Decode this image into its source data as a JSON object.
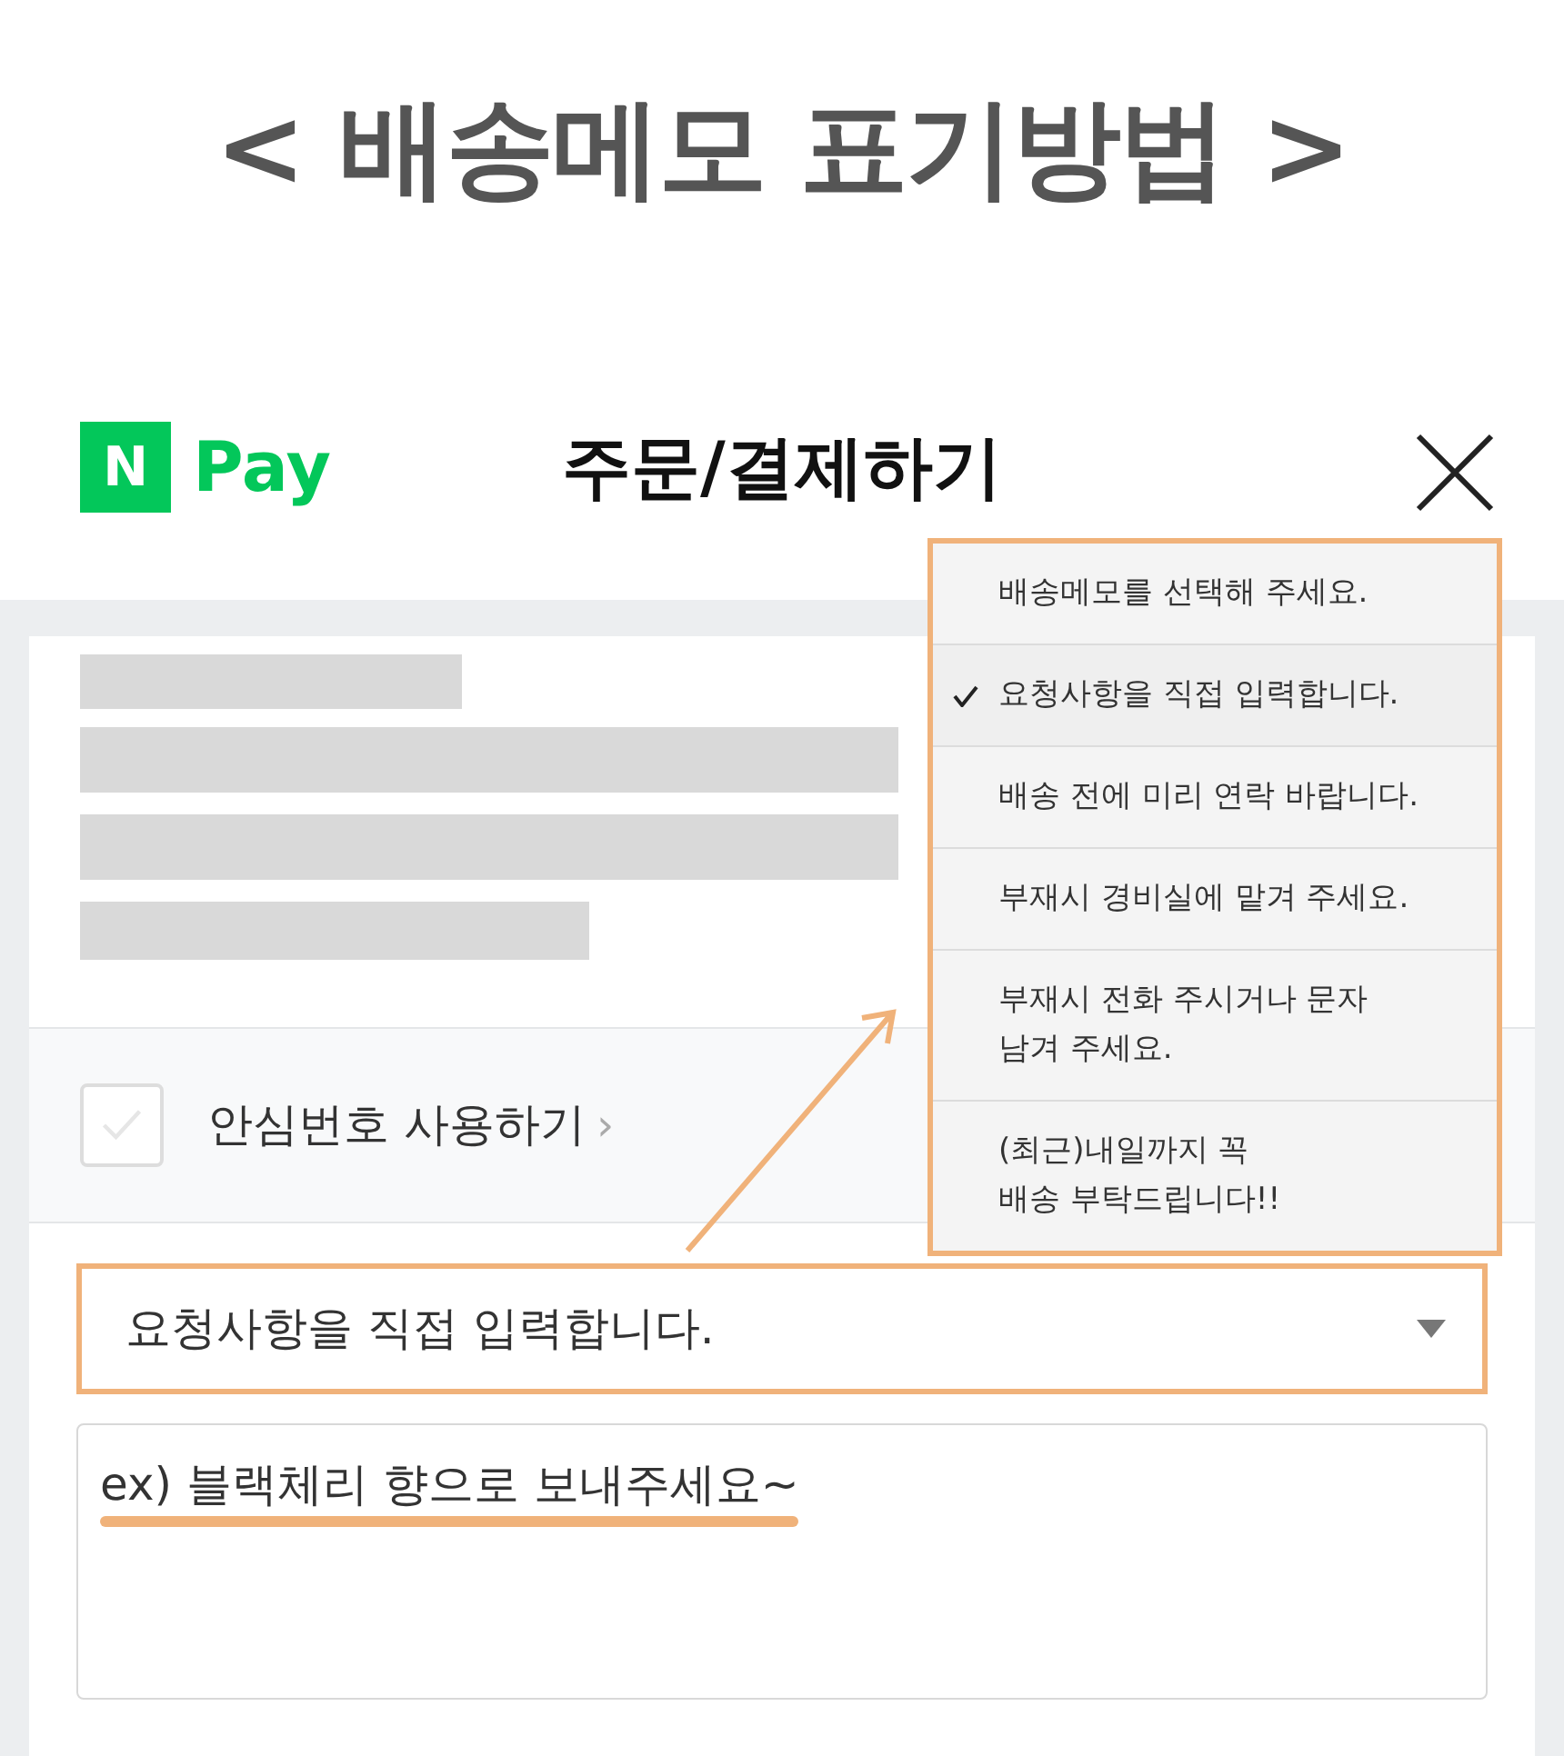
{
  "heading": "< 배송메모 표기방법 >",
  "header": {
    "logo_mark": "N",
    "logo_text": "Pay",
    "title": "주문/결제하기"
  },
  "safe_number": {
    "label": "안심번호 사용하기",
    "chevron": "›",
    "checked": false
  },
  "memo_select": {
    "value": "요청사항을 직접 입력합니다."
  },
  "memo_text": {
    "value": "ex) 블랙체리 향으로 보내주세요~"
  },
  "memo_menu": [
    {
      "label": "배송메모를 선택해 주세요.",
      "selected": false
    },
    {
      "label": "요청사항을 직접 입력합니다.",
      "selected": true
    },
    {
      "label": "배송 전에 미리 연락 바랍니다.",
      "selected": false
    },
    {
      "label": "부재시 경비실에 맡겨 주세요.",
      "selected": false
    },
    {
      "label": "부재시 전화 주시거나 문자\n남겨 주세요.",
      "selected": false
    },
    {
      "label": "(최근)내일까지 꼭\n배송 부탁드립니다!!",
      "selected": false
    }
  ]
}
